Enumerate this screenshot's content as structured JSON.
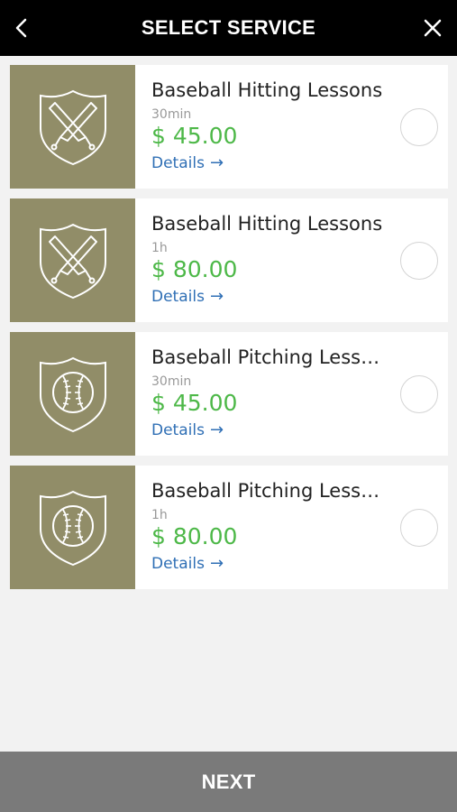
{
  "header": {
    "title": "SELECT SERVICE",
    "back_icon": "chevron-left-icon",
    "close_icon": "close-icon"
  },
  "services": [
    {
      "name": "Baseball Hitting Lessons",
      "duration": "30min",
      "price": "$ 45.00",
      "details_label": "Details",
      "icon": "crossed-bats-shield-icon"
    },
    {
      "name": "Baseball Hitting Lessons",
      "duration": "1h",
      "price": "$ 80.00",
      "details_label": "Details",
      "icon": "crossed-bats-shield-icon"
    },
    {
      "name": "Baseball Pitching Lessons",
      "duration": "30min",
      "price": "$ 45.00",
      "details_label": "Details",
      "icon": "baseball-shield-icon"
    },
    {
      "name": "Baseball Pitching Lessons",
      "duration": "1h",
      "price": "$ 80.00",
      "details_label": "Details",
      "icon": "baseball-shield-icon"
    }
  ],
  "footer": {
    "next_label": "NEXT"
  },
  "colors": {
    "header_bg": "#000000",
    "thumb_bg": "#918d68",
    "price": "#4db848",
    "link": "#2f6fb5",
    "footer_bg": "#7a7a7a"
  }
}
